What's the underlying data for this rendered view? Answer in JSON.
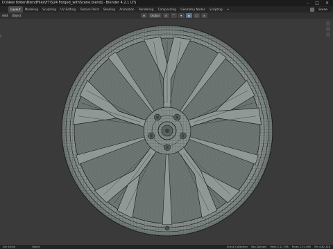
{
  "window": {
    "title": "D:\\New folder\\BlendFiles\\F7\\S24 Forged_withScene.blend] - Blender 4.2.1 LTS",
    "controls": [
      "–",
      "□",
      "✕"
    ]
  },
  "menubar": {
    "tabs": [
      {
        "label": "Layout",
        "active": true
      },
      {
        "label": "Modeling",
        "active": false
      },
      {
        "label": "Sculpting",
        "active": false
      },
      {
        "label": "UV Editing",
        "active": false
      },
      {
        "label": "Texture Paint",
        "active": false
      },
      {
        "label": "Shading",
        "active": false
      },
      {
        "label": "Animation",
        "active": false
      },
      {
        "label": "Rendering",
        "active": false
      },
      {
        "label": "Compositing",
        "active": false
      },
      {
        "label": "Geometry Nodes",
        "active": false
      },
      {
        "label": "Scripting",
        "active": false
      },
      {
        "label": "+",
        "active": false
      }
    ],
    "scene_label": "Scene"
  },
  "header": {
    "left_items": [
      "Add",
      "Object"
    ],
    "orientation": "Global"
  },
  "statusbar": {
    "left": [
      "Set Active",
      "Object"
    ],
    "right": [
      "Scene Collection",
      "Sep_Domain",
      "Verts 2,11,798",
      "Faces 2,51,498",
      "Tris 4,82,146"
    ]
  },
  "viewport": {
    "background": "#3a3a3a",
    "wheel_fill": "#8f9895",
    "wire_color": "#1f2322"
  }
}
